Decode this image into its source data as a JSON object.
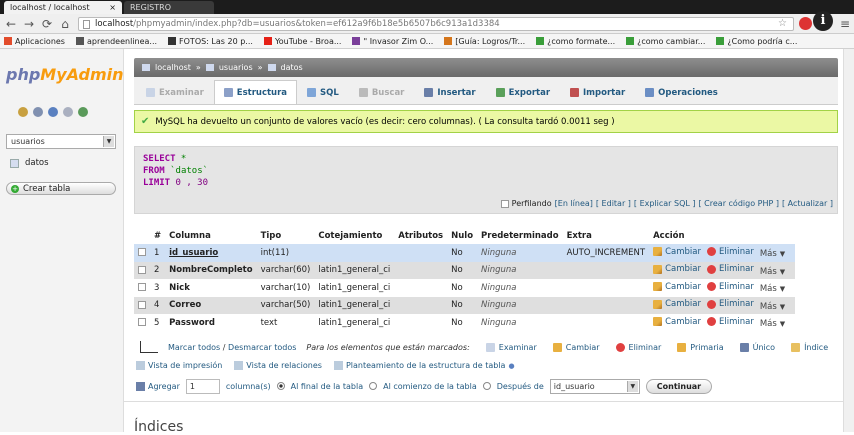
{
  "browser": {
    "tabs": [
      {
        "title": "localhost / localhost",
        "close": "×"
      },
      {
        "title": "REGISTRO"
      }
    ],
    "url_host": "localhost",
    "url_path": "/phpmyadmin/index.php?db=usuarios&token=ef612a9f6b18e5b6507b6c913a1d3384",
    "info_glyph": "i",
    "bookmarks": [
      {
        "label": "Aplicaciones",
        "color": "#e24c2c"
      },
      {
        "label": "aprendeenlinea...",
        "color": "#555555"
      },
      {
        "label": "FOTOS: Las 20 p...",
        "color": "#333333"
      },
      {
        "label": "YouTube - Broa...",
        "color": "#e62117"
      },
      {
        "label": "\" Invasor Zim O...",
        "color": "#7a3f9a"
      },
      {
        "label": "[Guía: Logros/Tr...",
        "color": "#d5761c"
      },
      {
        "label": "¿como formate...",
        "color": "#3a9e3a"
      },
      {
        "label": "¿como cambiar...",
        "color": "#3a9e3a"
      },
      {
        "label": "¿Como podría c...",
        "color": "#3a9e3a"
      }
    ]
  },
  "sidebar": {
    "logo_php": "php",
    "logo_myadmin": "MyAdmin",
    "db_selected": "usuarios",
    "tables": [
      "datos"
    ],
    "create_table": "Crear tabla"
  },
  "breadcrumb": {
    "server": "localhost",
    "db": "usuarios",
    "table": "datos",
    "sep": "»"
  },
  "tabs": [
    {
      "label": "Examinar",
      "state": "disabled",
      "icon_color": "#c9d4e6"
    },
    {
      "label": "Estructura",
      "state": "active",
      "icon_color": "#8ca0c8"
    },
    {
      "label": "SQL",
      "state": "normal",
      "icon_color": "#7fa6d8"
    },
    {
      "label": "Buscar",
      "state": "disabled",
      "icon_color": "#bbbbbb"
    },
    {
      "label": "Insertar",
      "state": "normal",
      "icon_color": "#6a7fa8"
    },
    {
      "label": "Exportar",
      "state": "normal",
      "icon_color": "#5aa05a"
    },
    {
      "label": "Importar",
      "state": "normal",
      "icon_color": "#c05050"
    },
    {
      "label": "Operaciones",
      "state": "normal",
      "icon_color": "#6b8ec4"
    }
  ],
  "message": {
    "check": "✔",
    "text": "MySQL ha devuelto un conjunto de valores vacío (es decir: cero columnas). ( La consulta tardó 0.0011 seg )"
  },
  "sql": {
    "select": "SELECT",
    "star": " *",
    "from": "FROM",
    "table": " `datos`",
    "limit": "LIMIT",
    "limit_vals": " 0 , 30",
    "profiling": "Perfilando",
    "links": [
      "[En línea]",
      "[ Editar ]",
      "[ Explicar SQL ]",
      "[ Crear código PHP ]",
      "[ Actualizar ]"
    ]
  },
  "structure": {
    "headers": [
      "#",
      "Columna",
      "Tipo",
      "Cotejamiento",
      "Atributos",
      "Nulo",
      "Predeterminado",
      "Extra",
      "Acción"
    ],
    "rows": [
      {
        "n": "1",
        "name": "id_usuario",
        "type": "int(11)",
        "collation": "",
        "attr": "",
        "null": "No",
        "default": "Ninguna",
        "extra": "AUTO_INCREMENT"
      },
      {
        "n": "2",
        "name": "NombreCompleto",
        "type": "varchar(60)",
        "collation": "latin1_general_ci",
        "attr": "",
        "null": "No",
        "default": "Ninguna",
        "extra": ""
      },
      {
        "n": "3",
        "name": "Nick",
        "type": "varchar(10)",
        "collation": "latin1_general_ci",
        "attr": "",
        "null": "No",
        "default": "Ninguna",
        "extra": ""
      },
      {
        "n": "4",
        "name": "Correo",
        "type": "varchar(50)",
        "collation": "latin1_general_ci",
        "attr": "",
        "null": "No",
        "default": "Ninguna",
        "extra": ""
      },
      {
        "n": "5",
        "name": "Password",
        "type": "text",
        "collation": "latin1_general_ci",
        "attr": "",
        "null": "No",
        "default": "Ninguna",
        "extra": ""
      }
    ],
    "actions": {
      "change": "Cambiar",
      "delete": "Eliminar",
      "more": "Más",
      "more_arrow": "▼"
    }
  },
  "bulk": {
    "mark_all": "Marcar todos",
    "sep": "/",
    "unmark_all": "Desmarcar todos",
    "for_marked": "Para los elementos que están marcados:",
    "buttons": [
      {
        "label": "Examinar",
        "color": "#c9d4e6"
      },
      {
        "label": "Cambiar",
        "color": "#e8b040"
      },
      {
        "label": "Eliminar",
        "color": "#e04040"
      },
      {
        "label": "Primaria",
        "color": "#e8b040"
      },
      {
        "label": "Único",
        "color": "#6a7fa8"
      },
      {
        "label": "Índice",
        "color": "#e8c060"
      }
    ]
  },
  "extras": {
    "print": "Vista de impresión",
    "relations": "Vista de relaciones",
    "plan": "Planteamiento de la estructura de tabla",
    "plan_icon": "●"
  },
  "add": {
    "label": "Agregar",
    "count": "1",
    "columns": "columna(s)",
    "end": "Al final de la tabla",
    "start": "Al comienzo de la tabla",
    "after": "Después de",
    "after_col": "id_usuario",
    "go": "Continuar"
  },
  "indices_title": "Índices"
}
